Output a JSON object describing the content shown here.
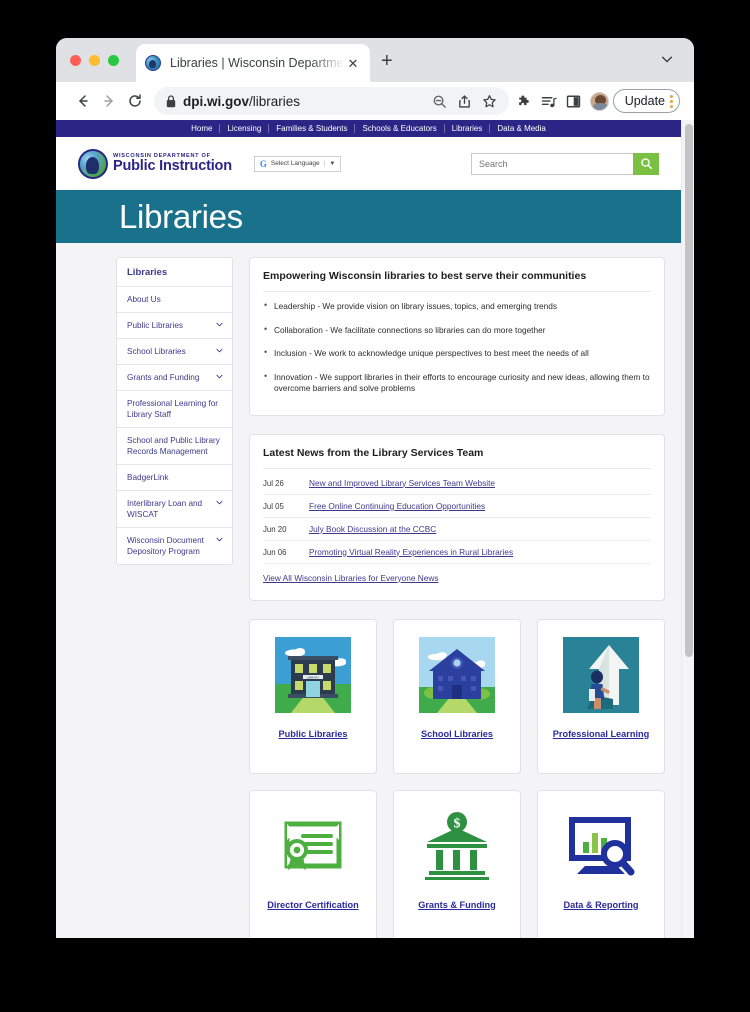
{
  "browser": {
    "tab": {
      "title": "Libraries | Wisconsin Departme",
      "close_label": "✕",
      "favicon_name": "dpi-favicon"
    },
    "new_tab_label": "+",
    "toolbar": {
      "back_label": "←",
      "forward_label": "→",
      "reload_label": "⟳",
      "url_prefix": "dpi.wi.gov",
      "url_path": "/libraries",
      "update_label": "Update"
    }
  },
  "site": {
    "topnav": [
      {
        "label": "Home"
      },
      {
        "label": "Licensing"
      },
      {
        "label": "Families & Students"
      },
      {
        "label": "Schools & Educators"
      },
      {
        "label": "Libraries"
      },
      {
        "label": "Data & Media"
      }
    ],
    "brand": {
      "line1": "WISCONSIN DEPARTMENT OF",
      "line2": "Public Instruction"
    },
    "translate": {
      "g_label": "G",
      "label": "Select Language",
      "caret": "▼"
    },
    "search": {
      "placeholder": "Search",
      "value": "",
      "button_name": "search-icon"
    },
    "hero_title": "Libraries"
  },
  "sidebar": {
    "title": "Libraries",
    "items": [
      {
        "label": "About Us",
        "expandable": false
      },
      {
        "label": "Public Libraries",
        "expandable": true
      },
      {
        "label": "School Libraries",
        "expandable": true
      },
      {
        "label": "Grants and Funding",
        "expandable": true
      },
      {
        "label": "Professional Learning for Library Staff",
        "expandable": false
      },
      {
        "label": "School and Public Library Records Management",
        "expandable": false
      },
      {
        "label": "BadgerLink",
        "expandable": false
      },
      {
        "label": "Interlibrary Loan and WISCAT",
        "expandable": true
      },
      {
        "label": "Wisconsin Document Depository Program",
        "expandable": true
      }
    ]
  },
  "mission": {
    "heading": "Empowering Wisconsin libraries to best serve their communities",
    "bullets": [
      "Leadership - We provide vision on library issues, topics, and emerging trends",
      "Collaboration - We facilitate connections so libraries can do more together",
      "Inclusion - We work to acknowledge unique perspectives to best meet the needs of all",
      "Innovation - We support libraries in their efforts to encourage curiosity and new ideas, allowing them to overcome barriers and solve problems"
    ]
  },
  "news": {
    "heading": "Latest News from the Library Services Team",
    "items": [
      {
        "date": "Jul 26",
        "title": "New and Improved Library Services Team Website"
      },
      {
        "date": "Jul 05",
        "title": "Free Online Continuing Education Opportunities"
      },
      {
        "date": "Jun 20",
        "title": "July Book Discussion at the CCBC"
      },
      {
        "date": "Jun 06",
        "title": "Promoting Virtual Reality Experiences in Rural Libraries"
      }
    ],
    "view_all": "View All Wisconsin Libraries for Everyone News"
  },
  "tiles": [
    {
      "label": "Public Libraries",
      "image_name": "public-library-building-image"
    },
    {
      "label": "School Libraries",
      "image_name": "school-library-building-image"
    },
    {
      "label": "Professional Learning",
      "image_name": "person-arrow-growth-image"
    },
    {
      "label": "Director Certification",
      "image_name": "certificate-icon"
    },
    {
      "label": "Grants & Funding",
      "image_name": "bank-dollar-icon"
    },
    {
      "label": "Data & Reporting",
      "image_name": "monitor-chart-magnifier-icon"
    }
  ],
  "colors": {
    "navy": "#2b2585",
    "teal": "#19718c",
    "link": "#3d3a8c",
    "tile_link": "#2a2a9e",
    "green": "#7ac143"
  }
}
